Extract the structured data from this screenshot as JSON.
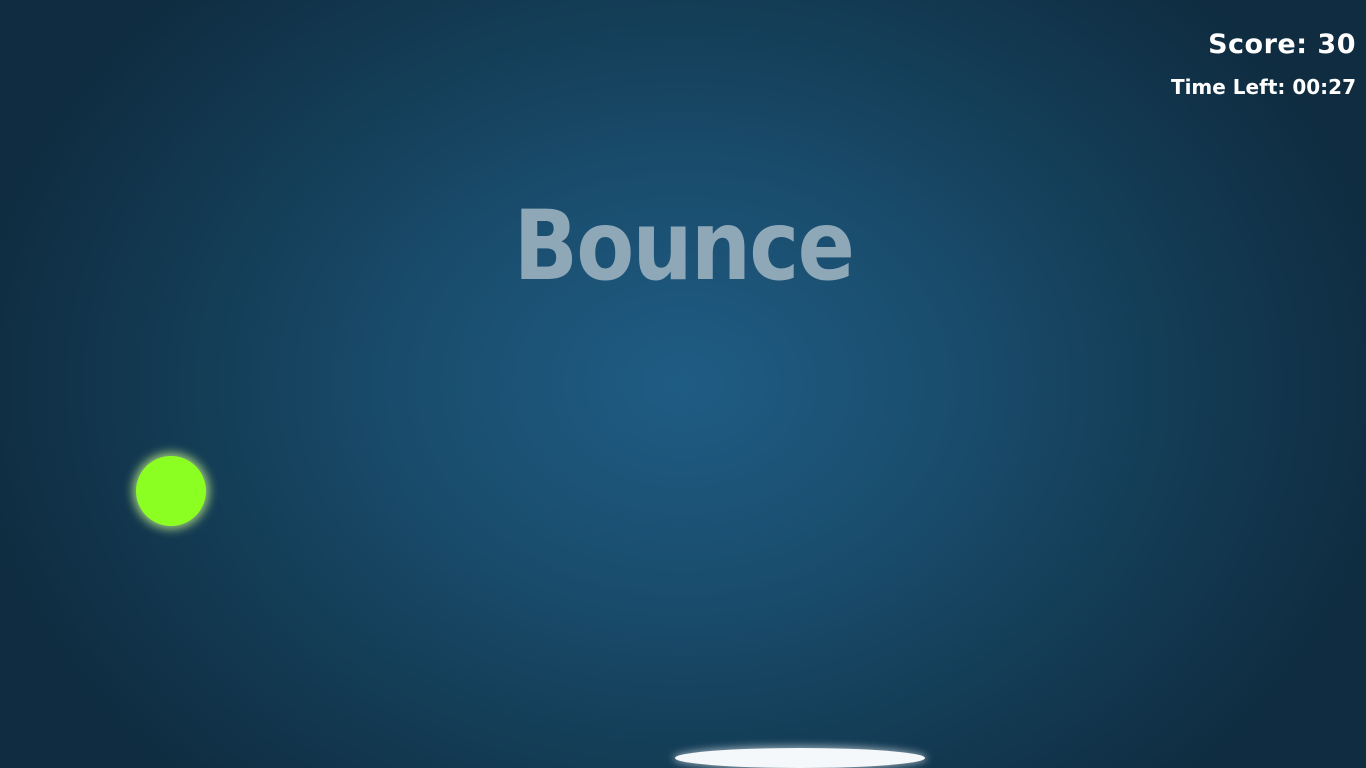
{
  "game": {
    "title": "Bounce"
  },
  "hud": {
    "score_text": "Score: 30",
    "time_text": "Time Left: 00:27"
  },
  "colors": {
    "background_center": "#1f5c84",
    "background_edge": "#0f2c40",
    "ball": "#8cff22",
    "paddle": "#f4f8fa",
    "title": "#8fa8b8",
    "hud_text": "#ffffff"
  }
}
